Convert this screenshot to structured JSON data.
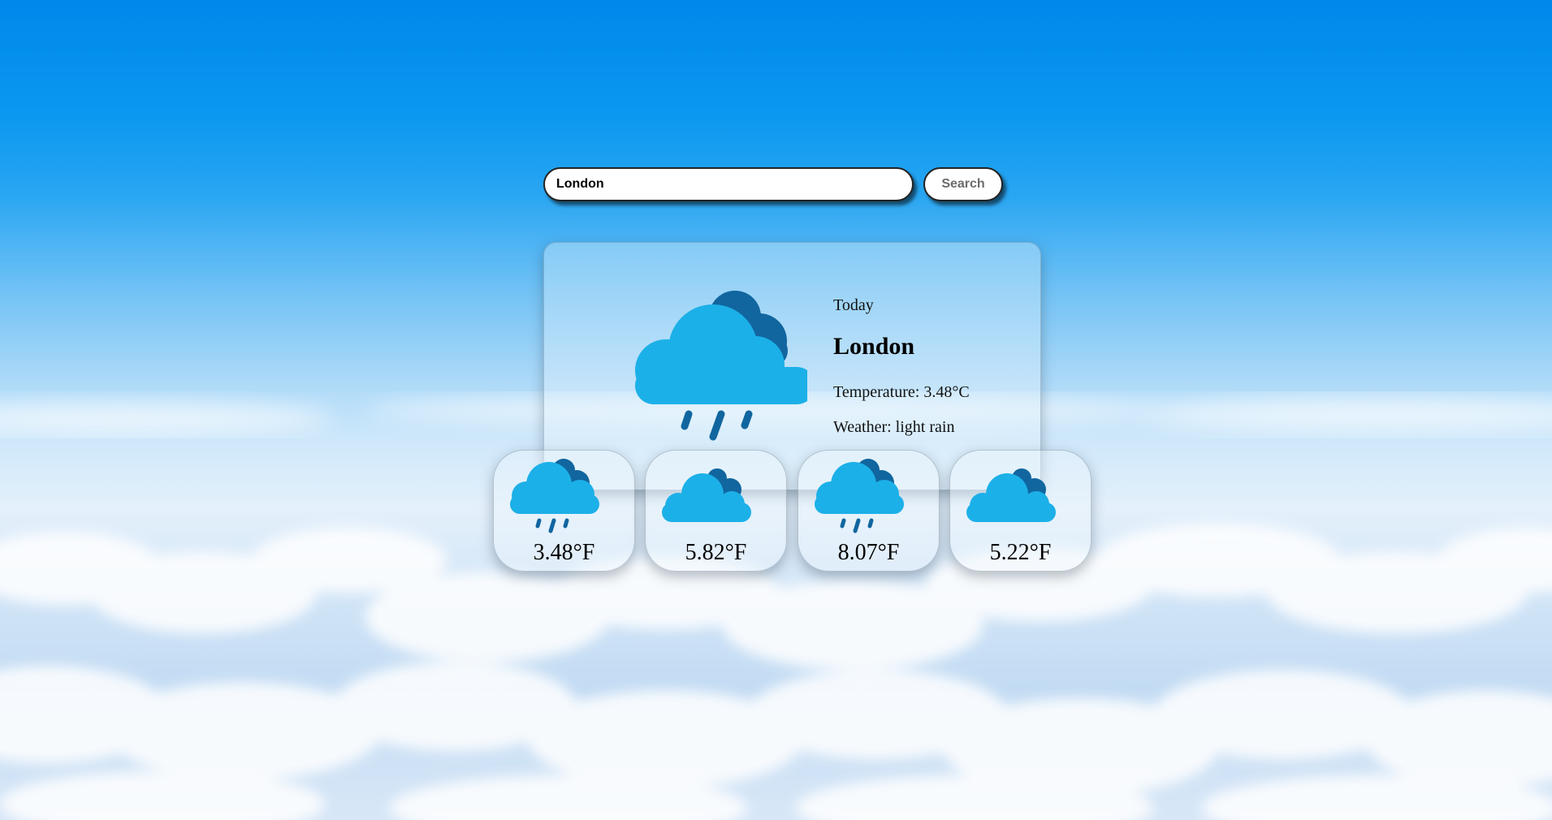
{
  "search": {
    "value": "London",
    "button_label": "Search"
  },
  "current": {
    "day_label": "Today",
    "city": "London",
    "temperature_text": "Temperature: 3.48°C",
    "weather_text": "Weather: light rain",
    "icon": "rain-cloud-icon"
  },
  "forecast": [
    {
      "temp": "3.48°F",
      "icon": "rain-cloud-icon"
    },
    {
      "temp": "5.82°F",
      "icon": "cloud-icon"
    },
    {
      "temp": "8.07°F",
      "icon": "rain-cloud-icon"
    },
    {
      "temp": "5.22°F",
      "icon": "cloud-icon"
    }
  ],
  "colors": {
    "cloud_light": "#1cb0e8",
    "cloud_dark": "#11669f",
    "rain": "#11669f"
  }
}
